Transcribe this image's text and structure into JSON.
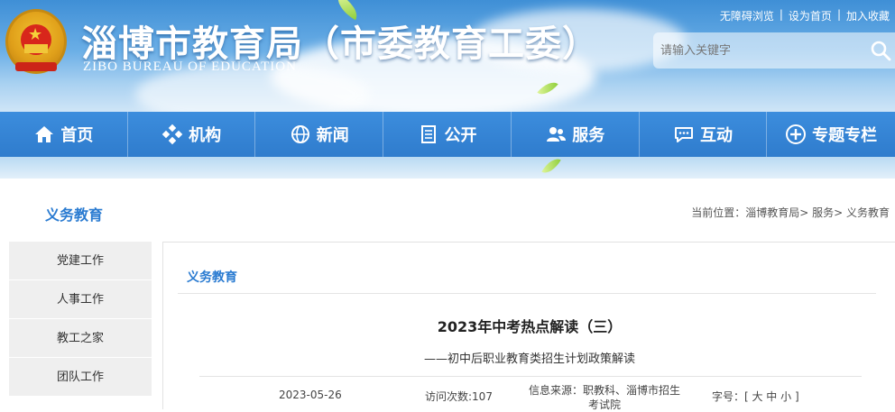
{
  "header": {
    "title": "淄博市教育局（市委教育工委）",
    "subtitle": "ZIBO BUREAU OF EDUCATION",
    "toplinks": [
      "无障碍浏览",
      "设为首页",
      "加入收藏"
    ],
    "search_placeholder": "请输入关键字"
  },
  "nav": [
    {
      "label": "首页",
      "icon": "home-icon"
    },
    {
      "label": "机构",
      "icon": "org-icon"
    },
    {
      "label": "新闻",
      "icon": "news-icon"
    },
    {
      "label": "公开",
      "icon": "document-icon"
    },
    {
      "label": "服务",
      "icon": "users-icon"
    },
    {
      "label": "互动",
      "icon": "chat-icon"
    },
    {
      "label": "专题专栏",
      "icon": "topics-icon"
    }
  ],
  "section": {
    "title": "义务教育",
    "breadcrumb_prefix": "当前位置：",
    "breadcrumb": [
      "淄博教育局",
      "服务",
      "义务教育"
    ]
  },
  "sidebar": [
    "党建工作",
    "人事工作",
    "教工之家",
    "团队工作"
  ],
  "article": {
    "category": "义务教育",
    "title": "2023年中考热点解读（三）",
    "subtitle": "——初中后职业教育类招生计划政策解读",
    "date": "2023-05-26",
    "visits": "访问次数:107",
    "source": "信息来源：职教科、淄博市招生考试院",
    "fontsize": "字号：[ 大 中 小 ]"
  },
  "colors": {
    "nav": "#3a8ad8",
    "accent": "#2a7bd1"
  }
}
